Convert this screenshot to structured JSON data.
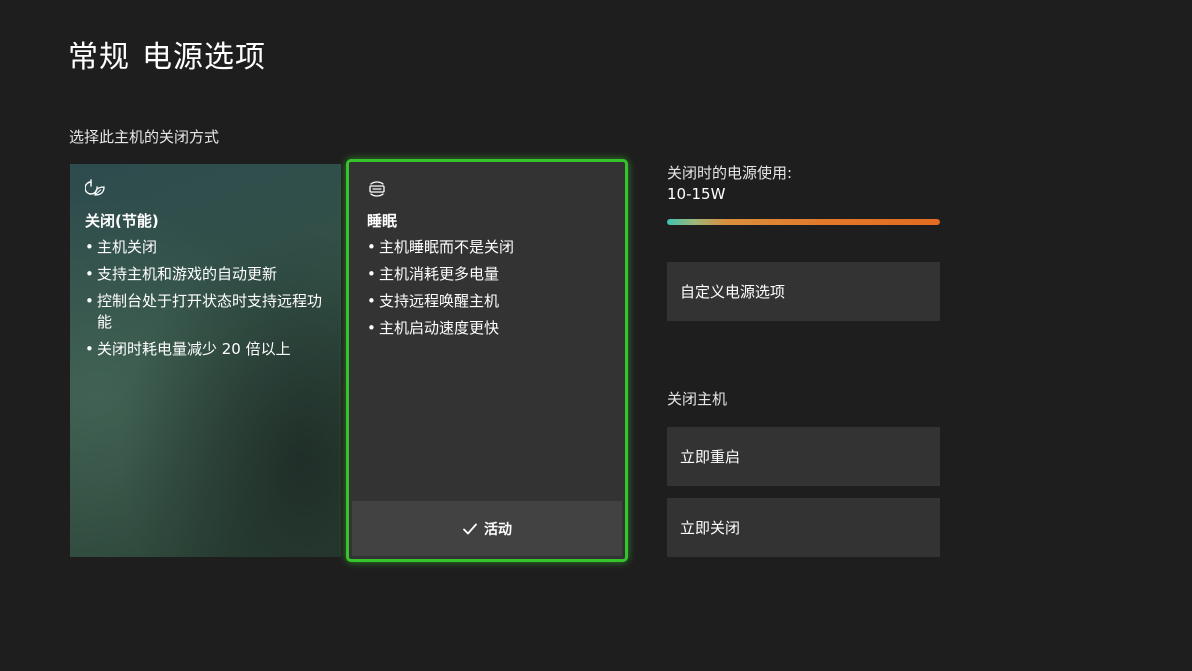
{
  "header": {
    "title_part1": "常规",
    "title_part2": "电源选项"
  },
  "mode_section": {
    "label": "选择此主机的关闭方式"
  },
  "cards": {
    "off": {
      "icon": "power-leaf-icon",
      "title": "关闭(节能)",
      "bullets": [
        "主机关闭",
        "支持主机和游戏的自动更新",
        "控制台处于打开状态时支持远程功能",
        "关闭时耗电量减少 20 倍以上"
      ]
    },
    "sleep": {
      "icon": "sleep-console-icon",
      "title": "睡眠",
      "bullets": [
        "主机睡眠而不是关闭",
        "主机消耗更多电量",
        "支持远程唤醒主机",
        "主机启动速度更快"
      ],
      "active_label": "活动",
      "active_icon": "checkmark-icon",
      "accent_color": "#35c42b"
    }
  },
  "power_usage": {
    "label": "关闭时的电源使用:",
    "value": "10-15W"
  },
  "custom_power": {
    "label": "自定义电源选项"
  },
  "shutdown_section": {
    "label": "关闭主机",
    "restart_label": "立即重启",
    "shutdown_label": "立即关闭"
  }
}
